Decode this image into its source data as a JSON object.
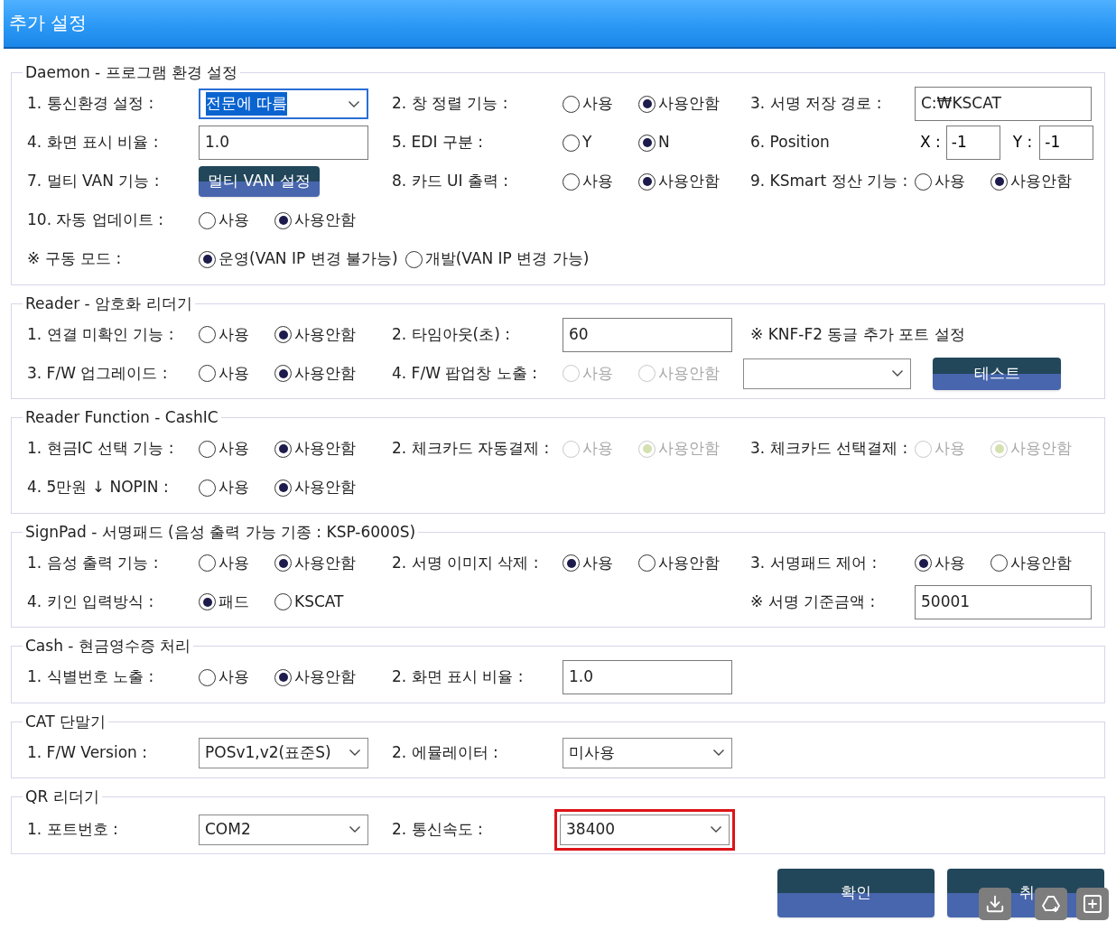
{
  "window": {
    "title": "추가 설정"
  },
  "sections": [
    {
      "title": "Daemon - 프로그램 환경 설정",
      "rows": [
        {
          "field_1": {
            "label": "1. 통신환경 설정 :",
            "controls": [
              {
                "kind": "select",
                "value": "전문에 따름",
                "focused": true,
                "text_selected": true,
                "flagged": false
              }
            ]
          },
          "field_2": {
            "label": "2. 창 정렬 기능 :",
            "controls": [
              {
                "kind": "radio",
                "disabled": false,
                "options": [
                  {
                    "label": "사용",
                    "selected": false
                  },
                  {
                    "label": "사용안함",
                    "selected": true
                  }
                ]
              }
            ]
          },
          "field_3": {
            "label": "3. 서명 저장 경로 :",
            "controls": [
              {
                "kind": "input",
                "value": "C:₩KSCAT"
              }
            ]
          }
        },
        {
          "field_1": {
            "label": "4. 화면 표시 비율 :",
            "controls": [
              {
                "kind": "input",
                "value": "1.0"
              }
            ]
          },
          "field_2": {
            "label": "5. EDI 구분 :",
            "controls": [
              {
                "kind": "radio",
                "disabled": false,
                "options": [
                  {
                    "label": "Y",
                    "selected": false
                  },
                  {
                    "label": "N",
                    "selected": true
                  }
                ]
              }
            ]
          },
          "field_3": {
            "label": "6. Position",
            "controls": [
              {
                "kind": "xy",
                "fields": [
                  {
                    "label": "X :",
                    "value": "-1"
                  },
                  {
                    "label": "Y :",
                    "value": "-1"
                  }
                ]
              }
            ]
          }
        },
        {
          "field_1": {
            "label": "7. 멀티 VAN 기능 :",
            "controls": [
              {
                "kind": "button",
                "label": "멀티 VAN 설정"
              }
            ]
          },
          "field_2": {
            "label": "8. 카드 UI 출력 :",
            "controls": [
              {
                "kind": "radio",
                "disabled": false,
                "options": [
                  {
                    "label": "사용",
                    "selected": false
                  },
                  {
                    "label": "사용안함",
                    "selected": true
                  }
                ]
              }
            ]
          },
          "field_3": {
            "label": "9. KSmart 정산 기능 :",
            "controls": [
              {
                "kind": "radio",
                "disabled": false,
                "options": [
                  {
                    "label": "사용",
                    "selected": false
                  },
                  {
                    "label": "사용안함",
                    "selected": true
                  }
                ]
              }
            ]
          }
        },
        {
          "field_1": {
            "label": "10. 자동 업데이트 :",
            "controls": [
              {
                "kind": "radio",
                "disabled": false,
                "options": [
                  {
                    "label": "사용",
                    "selected": false
                  },
                  {
                    "label": "사용안함",
                    "selected": true
                  }
                ]
              }
            ]
          }
        },
        {
          "field_1": {
            "label": "※ 구동 모드 :",
            "controls": [
              {
                "kind": "radio",
                "disabled": false,
                "options": [
                  {
                    "label": "운영(VAN IP 변경 불가능)",
                    "selected": true
                  },
                  {
                    "label": "개발(VAN IP 변경 가능)",
                    "selected": false
                  }
                ]
              }
            ]
          }
        }
      ]
    },
    {
      "title": "Reader - 암호화 리더기",
      "rows": [
        {
          "field_1": {
            "label": "1. 연결 미확인 기능 :",
            "controls": [
              {
                "kind": "radio",
                "disabled": false,
                "options": [
                  {
                    "label": "사용",
                    "selected": false
                  },
                  {
                    "label": "사용안함",
                    "selected": true
                  }
                ]
              }
            ]
          },
          "field_2": {
            "label": "2. 타임아웃(초) :",
            "controls": [
              {
                "kind": "input",
                "value": "60"
              }
            ]
          },
          "field_3": {
            "label": "※ KNF-F2 동글 추가 포트 설정"
          }
        },
        {
          "field_1": {
            "label": "3. F/W 업그레이드 :",
            "controls": [
              {
                "kind": "radio",
                "disabled": false,
                "options": [
                  {
                    "label": "사용",
                    "selected": false
                  },
                  {
                    "label": "사용안함",
                    "selected": true
                  }
                ]
              }
            ]
          },
          "field_2": {
            "label": "4. F/W 팝업창 노출 :",
            "controls": [
              {
                "kind": "radio",
                "disabled": true,
                "options": [
                  {
                    "label": "사용",
                    "selected": false
                  },
                  {
                    "label": "사용안함",
                    "selected": false
                  }
                ]
              }
            ]
          },
          "field_3": {
            "controls": [
              {
                "kind": "select",
                "focused": false,
                "flagged": false
              },
              {
                "kind": "button",
                "label": "테스트"
              }
            ]
          }
        }
      ]
    },
    {
      "title": "Reader Function - CashIC",
      "rows": [
        {
          "field_1": {
            "label": "1. 현금IC 선택 기능 :",
            "controls": [
              {
                "kind": "radio",
                "disabled": false,
                "options": [
                  {
                    "label": "사용",
                    "selected": false
                  },
                  {
                    "label": "사용안함",
                    "selected": true
                  }
                ]
              }
            ]
          },
          "field_2": {
            "label": "2. 체크카드 자동결제 :",
            "controls": [
              {
                "kind": "radio",
                "disabled": true,
                "options": [
                  {
                    "label": "사용",
                    "selected": false
                  },
                  {
                    "label": "사용안함",
                    "selected": true
                  }
                ]
              }
            ]
          },
          "field_3": {
            "label": "3. 체크카드 선택결제 :",
            "controls": [
              {
                "kind": "radio",
                "disabled": true,
                "options": [
                  {
                    "label": "사용",
                    "selected": false
                  },
                  {
                    "label": "사용안함",
                    "selected": true
                  }
                ]
              }
            ]
          }
        },
        {
          "field_1": {
            "label": "4. 5만원 ↓ NOPIN :",
            "controls": [
              {
                "kind": "radio",
                "disabled": false,
                "options": [
                  {
                    "label": "사용",
                    "selected": false
                  },
                  {
                    "label": "사용안함",
                    "selected": true
                  }
                ]
              }
            ]
          }
        }
      ]
    },
    {
      "title": "SignPad - 서명패드 (음성 출력 가능 기종 : KSP-6000S)",
      "rows": [
        {
          "field_1": {
            "label": "1. 음성 출력 기능 :",
            "controls": [
              {
                "kind": "radio",
                "disabled": false,
                "options": [
                  {
                    "label": "사용",
                    "selected": false
                  },
                  {
                    "label": "사용안함",
                    "selected": true
                  }
                ]
              }
            ]
          },
          "field_2": {
            "label": "2. 서명 이미지 삭제 :",
            "controls": [
              {
                "kind": "radio",
                "disabled": false,
                "options": [
                  {
                    "label": "사용",
                    "selected": true
                  },
                  {
                    "label": "사용안함",
                    "selected": false
                  }
                ]
              }
            ]
          },
          "field_3": {
            "label": "3. 서명패드 제어 :",
            "controls": [
              {
                "kind": "radio",
                "disabled": false,
                "options": [
                  {
                    "label": "사용",
                    "selected": true
                  },
                  {
                    "label": "사용안함",
                    "selected": false
                  }
                ]
              }
            ]
          }
        },
        {
          "field_1": {
            "label": "4. 키인 입력방식 :",
            "controls": [
              {
                "kind": "radio",
                "disabled": false,
                "options": [
                  {
                    "label": "패드",
                    "selected": true
                  },
                  {
                    "label": "KSCAT",
                    "selected": false
                  }
                ]
              }
            ]
          },
          "field_3": {
            "label": "※ 서명 기준금액 :",
            "controls": [
              {
                "kind": "input",
                "value": "50001"
              }
            ]
          }
        }
      ]
    },
    {
      "title": "Cash - 현금영수증 처리",
      "rows": [
        {
          "field_1": {
            "label": "1. 식별번호 노출 :",
            "controls": [
              {
                "kind": "radio",
                "disabled": false,
                "options": [
                  {
                    "label": "사용",
                    "selected": false
                  },
                  {
                    "label": "사용안함",
                    "selected": true
                  }
                ]
              }
            ]
          },
          "field_2": {
            "label": "2. 화면 표시 비율 :",
            "controls": [
              {
                "kind": "input",
                "value": "1.0"
              }
            ]
          }
        }
      ]
    },
    {
      "title": "CAT 단말기",
      "rows": [
        {
          "field_1": {
            "label": "1. F/W Version :",
            "controls": [
              {
                "kind": "select",
                "value": "POSv1,v2(표준S)",
                "focused": false,
                "text_selected": false,
                "flagged": false
              }
            ]
          },
          "field_2": {
            "label": "2. 에뮬레이터 :",
            "controls": [
              {
                "kind": "select",
                "value": "미사용",
                "focused": false,
                "text_selected": false,
                "flagged": false
              }
            ]
          }
        }
      ]
    },
    {
      "title": "QR 리더기",
      "rows": [
        {
          "field_1": {
            "label": "1. 포트번호 :",
            "controls": [
              {
                "kind": "select",
                "value": "COM2",
                "focused": false,
                "text_selected": false,
                "flagged": false
              }
            ]
          },
          "field_2": {
            "label": "2. 통신속도 :",
            "controls": [
              {
                "kind": "select",
                "value": "38400",
                "focused": false,
                "text_selected": false,
                "flagged": true
              }
            ]
          }
        }
      ]
    }
  ],
  "footer": {
    "buttons": [
      {
        "label": "확인"
      },
      {
        "label": "취"
      }
    ]
  }
}
